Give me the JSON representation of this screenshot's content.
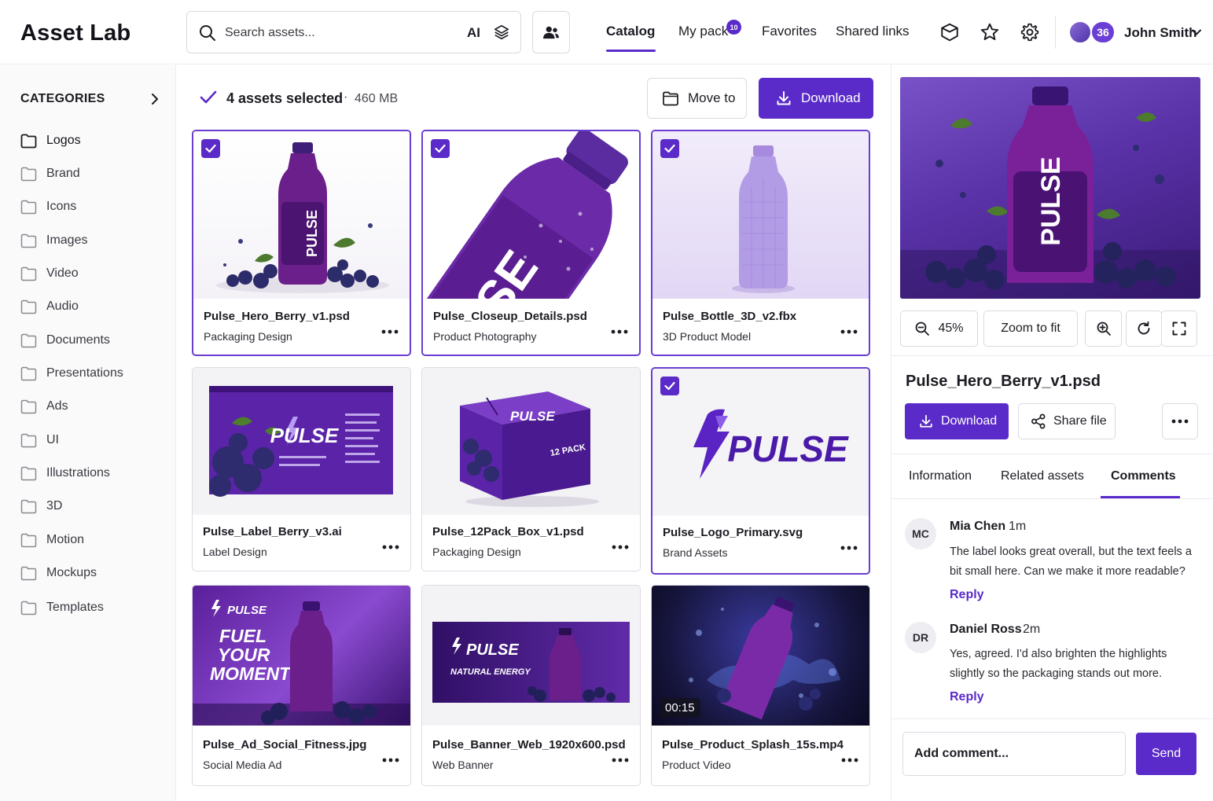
{
  "app": {
    "title": "Asset Lab"
  },
  "search": {
    "placeholder": "Search assets...",
    "ai_label": "AI"
  },
  "nav": [
    {
      "label": "Catalog",
      "active": true
    },
    {
      "label": "My pack",
      "badge": "10"
    },
    {
      "label": "Favorites"
    },
    {
      "label": "Shared links"
    }
  ],
  "user": {
    "name": "John Smith",
    "avatar_count": "36"
  },
  "sidebar": {
    "title": "CATEGORIES",
    "items": [
      {
        "label": "Logos",
        "active": true
      },
      {
        "label": "Brand"
      },
      {
        "label": "Icons"
      },
      {
        "label": "Images"
      },
      {
        "label": "Video"
      },
      {
        "label": "Audio"
      },
      {
        "label": "Documents"
      },
      {
        "label": "Presentations"
      },
      {
        "label": "Ads"
      },
      {
        "label": "UI"
      },
      {
        "label": "Illustrations"
      },
      {
        "label": "3D"
      },
      {
        "label": "Motion"
      },
      {
        "label": "Mockups"
      },
      {
        "label": "Templates"
      }
    ]
  },
  "selection": {
    "text": "4 assets selected",
    "separator": "·",
    "size": "460 MB",
    "move_label": "Move to",
    "download_label": "Download"
  },
  "assets": [
    {
      "name": "Pulse_Hero_Berry_v1.psd",
      "type": "Packaging Design",
      "selected": true
    },
    {
      "name": "Pulse_Closeup_Details.psd",
      "type": "Product Photography",
      "selected": true
    },
    {
      "name": "Pulse_Bottle_3D_v2.fbx",
      "type": "3D Product Model",
      "selected": true
    },
    {
      "name": "Pulse_Label_Berry_v3.ai",
      "type": "Label Design",
      "selected": false
    },
    {
      "name": "Pulse_12Pack_Box_v1.psd",
      "type": "Packaging Design",
      "selected": false
    },
    {
      "name": "Pulse_Logo_Primary.svg",
      "type": "Brand Assets",
      "selected": true
    },
    {
      "name": "Pulse_Ad_Social_Fitness.jpg",
      "type": "Social Media Ad",
      "selected": false
    },
    {
      "name": "Pulse_Banner_Web_1920x600.psd",
      "type": "Web Banner",
      "selected": false
    },
    {
      "name": "Pulse_Product_Splash_15s.mp4",
      "type": "Product Video",
      "selected": false,
      "duration": "00:15"
    }
  ],
  "thumb_text": {
    "brand": "PULSE",
    "pack": "12 PACK",
    "ad_headline": [
      "FUEL",
      "YOUR",
      "MOMENT"
    ],
    "banner_tagline": "NATURAL ENERGY"
  },
  "preview": {
    "zoom": "45%",
    "zoom_to_fit": "Zoom to fit",
    "file_name": "Pulse_Hero_Berry_v1.psd",
    "download_label": "Download",
    "share_label": "Share file"
  },
  "tabs": [
    {
      "label": "Information"
    },
    {
      "label": "Related assets"
    },
    {
      "label": "Comments",
      "active": true
    }
  ],
  "comments": [
    {
      "initials": "MC",
      "author": "Mia Chen",
      "time": "1m",
      "text": "The label looks great overall, but the text feels a bit small here. Can we make it more readable?",
      "reply_label": "Reply"
    },
    {
      "initials": "DR",
      "author": "Daniel Ross",
      "time": "2m",
      "text": "Yes, agreed. I'd also brighten the highlights slightly so the packaging stands out more.",
      "reply_label": "Reply"
    }
  ],
  "comment_input": {
    "placeholder": "Add comment...",
    "send_label": "Send"
  },
  "colors": {
    "accent": "#5a2bc8",
    "selection_border": "#6a3ed0",
    "text": "#1d1b22"
  }
}
